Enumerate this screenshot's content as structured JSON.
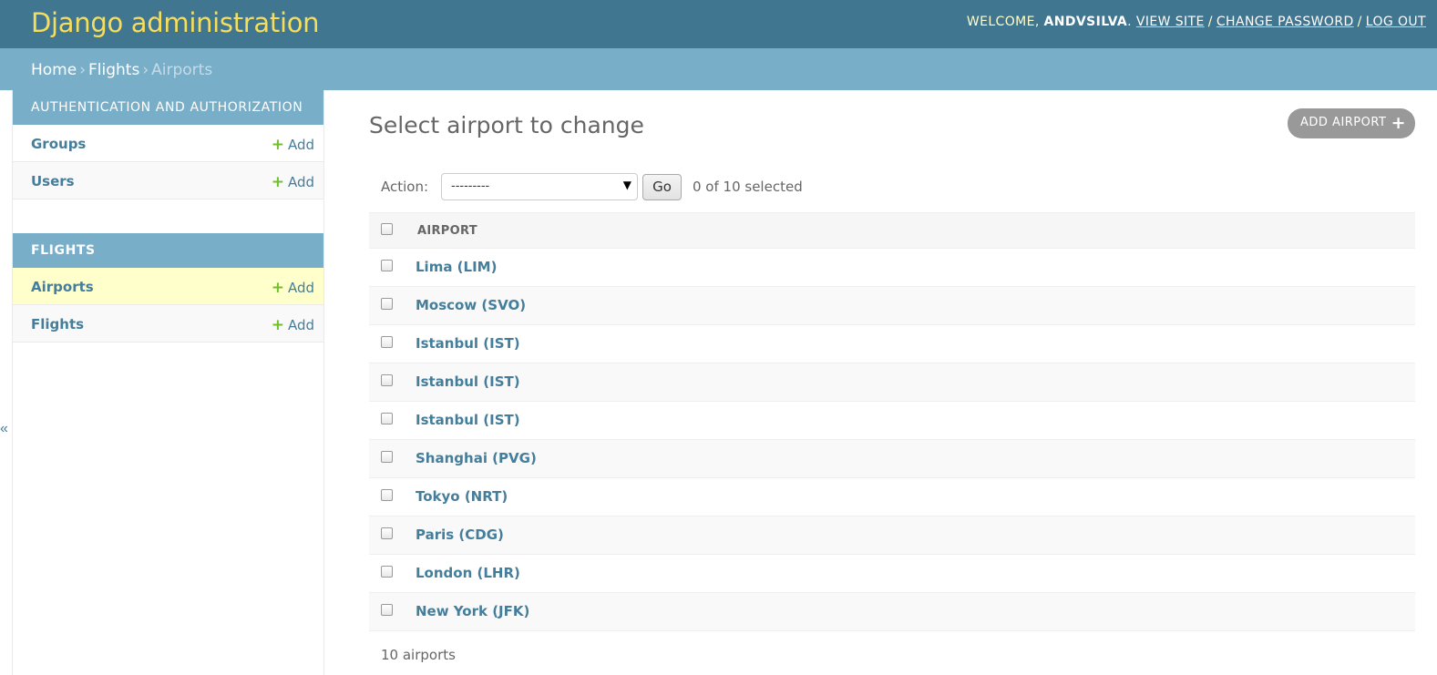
{
  "header": {
    "branding": "Django administration",
    "welcome": "WELCOME,",
    "username": "ANDVSILVA",
    "view_site": "VIEW SITE",
    "change_password": "CHANGE PASSWORD",
    "log_out": "LOG OUT"
  },
  "breadcrumbs": {
    "home": "Home",
    "app": "Flights",
    "current": "Airports"
  },
  "sidebar": {
    "toggle": "«",
    "modules": [
      {
        "caption": "AUTHENTICATION AND AUTHORIZATION",
        "models": [
          {
            "name": "Groups",
            "add": "Add"
          },
          {
            "name": "Users",
            "add": "Add"
          }
        ]
      },
      {
        "caption": "FLIGHTS",
        "models": [
          {
            "name": "Airports",
            "add": "Add"
          },
          {
            "name": "Flights",
            "add": "Add"
          }
        ]
      }
    ]
  },
  "content": {
    "title": "Select airport to change",
    "add_button": "ADD AIRPORT",
    "actions": {
      "label": "Action:",
      "selected_option": "---------",
      "go": "Go",
      "counter": "0 of 10 selected"
    },
    "column_header": "AIRPORT",
    "rows": [
      "Lima (LIM)",
      "Moscow (SVO)",
      "Istanbul (IST)",
      "Istanbul (IST)",
      "Istanbul (IST)",
      "Shanghai (PVG)",
      "Tokyo (NRT)",
      "Paris (CDG)",
      "London (LHR)",
      "New York (JFK)"
    ],
    "paginator": "10 airports"
  }
}
